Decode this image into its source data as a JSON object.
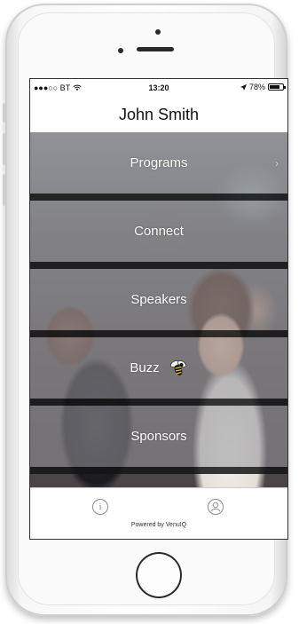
{
  "status_bar": {
    "carrier": "●●●○○ BT",
    "time": "13:20",
    "battery": "78%",
    "battery_level": 0.78
  },
  "header": {
    "title": "John Smith"
  },
  "menu": {
    "items": [
      {
        "label": "Programs"
      },
      {
        "label": "Connect"
      },
      {
        "label": "Speakers"
      },
      {
        "label": "Buzz"
      },
      {
        "label": "Sponsors"
      }
    ]
  },
  "footer": {
    "powered_by": "Powered by VenuIQ",
    "info_icon": "info-icon",
    "profile_icon": "user-icon"
  },
  "icons": {
    "wifi": "wifi-icon",
    "location": "location-arrow-icon",
    "battery": "battery-icon",
    "bee": "bee-icon",
    "chevron": "chevron-right-icon"
  },
  "colors": {
    "menu_overlay": "#9696a0",
    "divider": "#141416",
    "text_on_photo": "#ffffff"
  }
}
